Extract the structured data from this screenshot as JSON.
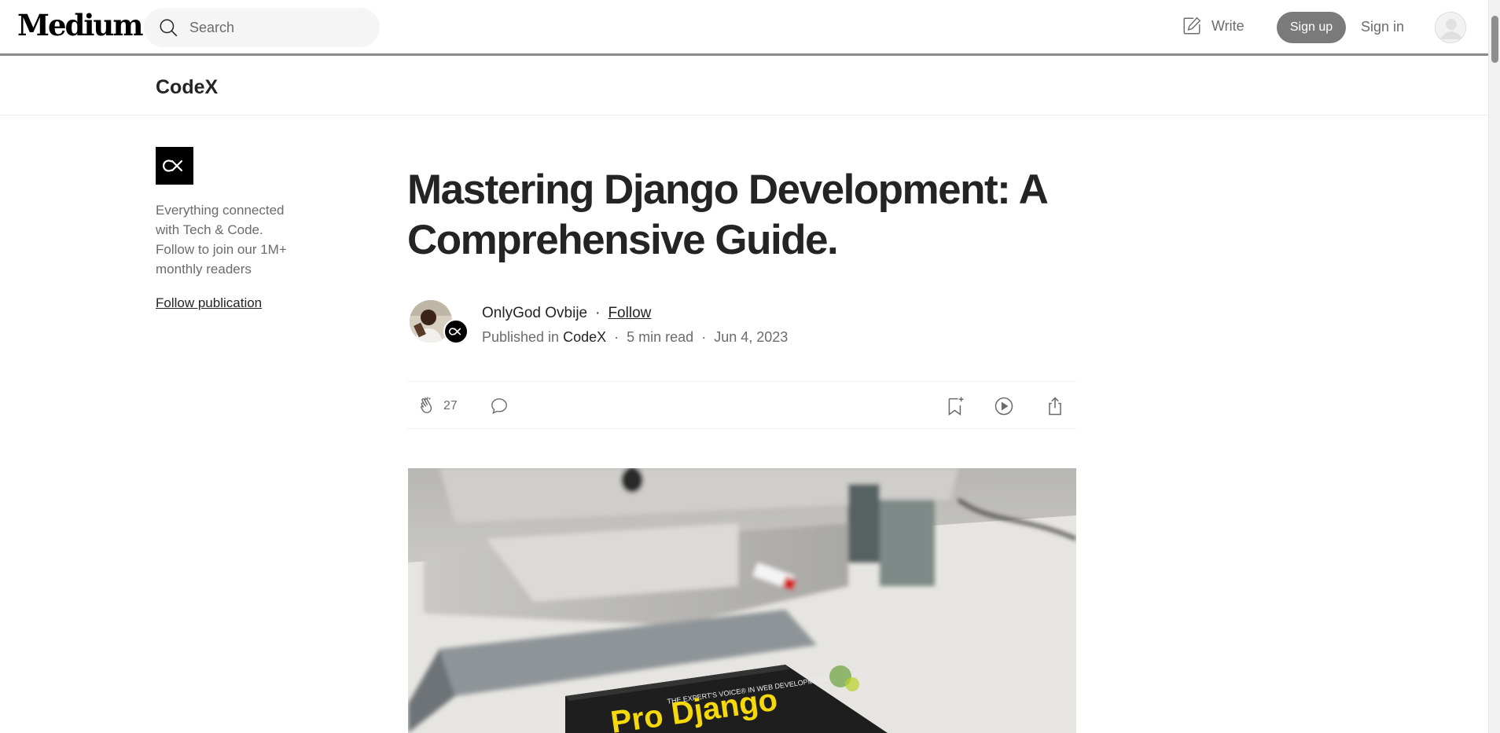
{
  "nav": {
    "logo": "Medium",
    "search_placeholder": "Search",
    "write": "Write",
    "sign_up": "Sign up",
    "sign_in": "Sign in"
  },
  "publication": {
    "name": "CodeX",
    "description": "Everything connected with Tech & Code. Follow to join our 1M+ monthly readers",
    "follow": "Follow publication"
  },
  "article": {
    "title": "Mastering Django Development: A Comprehensive Guide.",
    "author": "OnlyGod Ovbije",
    "follow": "Follow",
    "published_in_prefix": "Published in",
    "publication_ref": "CodeX",
    "read_time": "5 min read",
    "date": "Jun 4, 2023",
    "claps": "27",
    "hero_book_text": "Pro Django",
    "hero_book_tagline": "THE EXPERT'S VOICE® IN WEB DEVELOPMENT"
  },
  "colors": {
    "text": "#242424",
    "muted": "#6b6b6b",
    "signup_bg": "#7a7a7a",
    "book_title": "#f5d90a"
  }
}
